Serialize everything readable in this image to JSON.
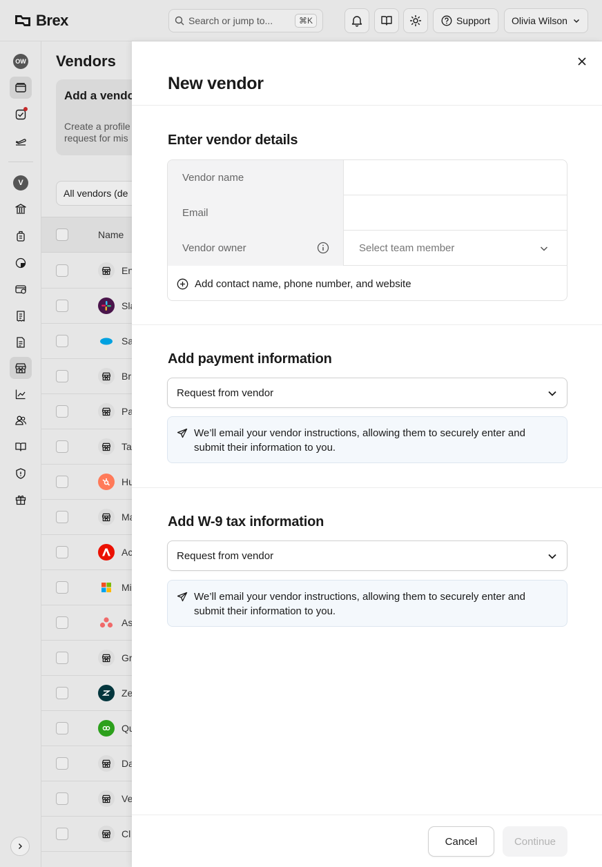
{
  "app": {
    "brand": "Brex"
  },
  "header": {
    "search_placeholder": "Search or jump to...",
    "search_shortcut": "⌘K",
    "support_label": "Support",
    "user_name": "Olivia Wilson"
  },
  "rail": {
    "user_initials": "OW",
    "entity_initial": "V"
  },
  "background_page": {
    "title": "Vendors",
    "promo_title": "Add a vendor",
    "promo_body_line1": "Create a profile",
    "promo_body_line2": "request for mis",
    "filter_label": "All vendors (de",
    "column_name": "Name",
    "rows": [
      {
        "name": "En",
        "logo": "storefront-icon",
        "color": "#e0e0e0"
      },
      {
        "name": "Sla",
        "logo": "slack-logo",
        "color": "#4a154b"
      },
      {
        "name": "Sa",
        "logo": "salesforce-logo",
        "color": "#00a1e0"
      },
      {
        "name": "Br",
        "logo": "storefront-icon",
        "color": "#e0e0e0"
      },
      {
        "name": "Pa",
        "logo": "storefront-icon",
        "color": "#e0e0e0"
      },
      {
        "name": "Ta",
        "logo": "storefront-icon",
        "color": "#e0e0e0"
      },
      {
        "name": "Hu",
        "logo": "hubspot-logo",
        "color": "#ff7a59"
      },
      {
        "name": "Ma",
        "logo": "storefront-icon",
        "color": "#e0e0e0"
      },
      {
        "name": "Ac",
        "logo": "adobe-logo",
        "color": "#eb1000"
      },
      {
        "name": "Mi",
        "logo": "microsoft-logo",
        "color": "#ffffff"
      },
      {
        "name": "As",
        "logo": "asana-logo",
        "color": "#f06a6a"
      },
      {
        "name": "Gr",
        "logo": "storefront-icon",
        "color": "#e0e0e0"
      },
      {
        "name": "Ze",
        "logo": "zendesk-logo",
        "color": "#03363d"
      },
      {
        "name": "Qu",
        "logo": "quickbooks-logo",
        "color": "#2ca01c"
      },
      {
        "name": "Da",
        "logo": "storefront-icon",
        "color": "#e0e0e0"
      },
      {
        "name": "Ve",
        "logo": "storefront-icon",
        "color": "#e0e0e0"
      },
      {
        "name": "Cl",
        "logo": "storefront-icon",
        "color": "#e0e0e0"
      }
    ]
  },
  "modal": {
    "title": "New vendor",
    "details": {
      "heading": "Enter vendor details",
      "vendor_name_label": "Vendor name",
      "vendor_name_value": "",
      "email_label": "Email",
      "email_value": "",
      "owner_label": "Vendor owner",
      "owner_placeholder": "Select team member",
      "add_contact_label": "Add contact name, phone number, and website"
    },
    "payment": {
      "heading": "Add payment information",
      "select_value": "Request from vendor",
      "notice": "We’ll email your vendor instructions, allowing them to securely enter and submit their information to you."
    },
    "tax": {
      "heading": "Add W-9 tax information",
      "select_value": "Request from vendor",
      "notice": "We’ll email your vendor instructions, allowing them to securely enter and submit their information to you."
    },
    "footer": {
      "cancel_label": "Cancel",
      "continue_label": "Continue"
    }
  }
}
